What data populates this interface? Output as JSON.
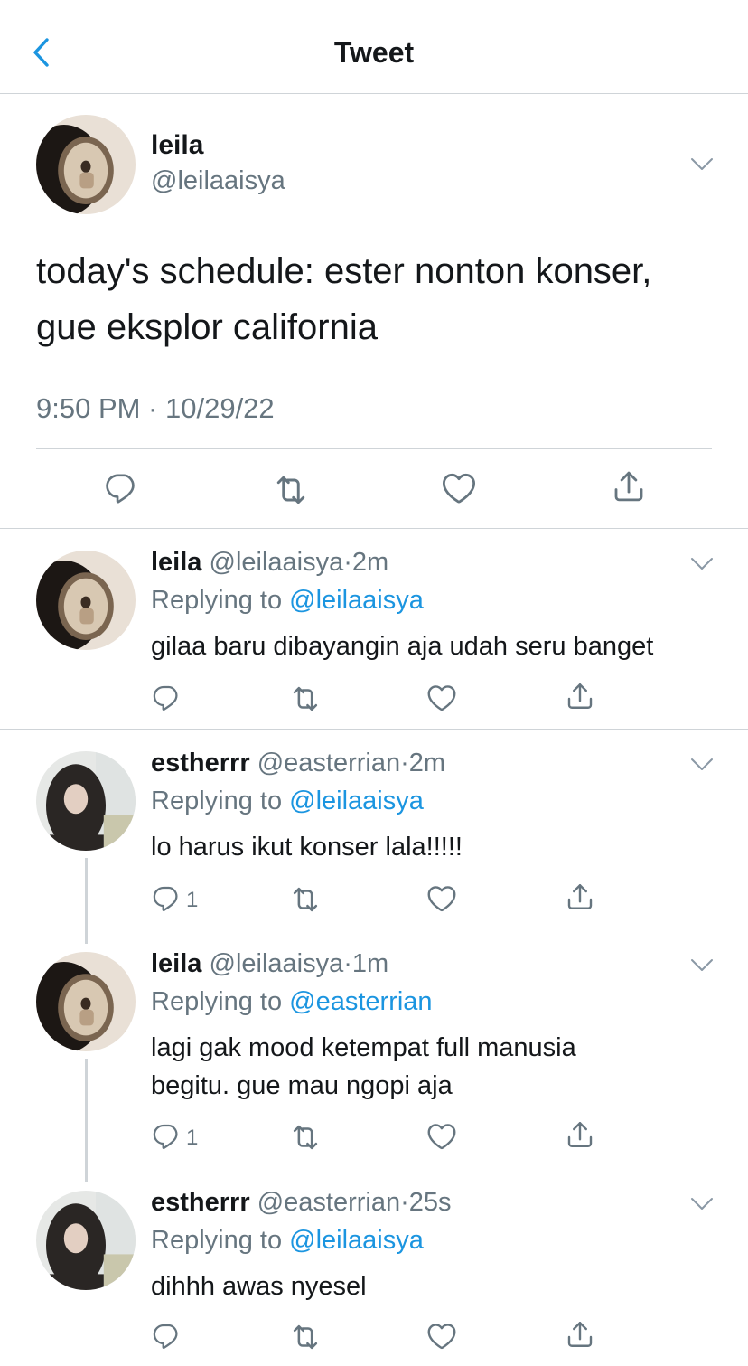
{
  "header": {
    "title": "Tweet"
  },
  "main_tweet": {
    "name": "leila",
    "handle": "@leilaaisya",
    "text_line1": "today's schedule: ester nonton konser,",
    "text_line2": "gue eksplor california",
    "timestamp": "9:50 PM · 10/29/22"
  },
  "replies": [
    {
      "name": "leila",
      "handle": "@leilaaisya",
      "time": "2m",
      "replying_label": "Replying to",
      "replying_to": "@leilaaisya",
      "text_line1": "gilaa baru dibayangin aja udah seru banget",
      "text_line2": "",
      "reply_count": ""
    },
    {
      "name": "estherrr",
      "handle": "@easterrian",
      "time": "2m",
      "replying_label": "Replying to",
      "replying_to": "@leilaaisya",
      "text_line1": "lo harus ikut konser lala!!!!!",
      "text_line2": "",
      "reply_count": "1"
    },
    {
      "name": "leila",
      "handle": "@leilaaisya",
      "time": "1m",
      "replying_label": "Replying to",
      "replying_to": "@easterrian",
      "text_line1": "lagi gak mood ketempat full manusia",
      "text_line2": "begitu. gue mau ngopi aja",
      "reply_count": "1"
    },
    {
      "name": "estherrr",
      "handle": "@easterrian",
      "time": "25s",
      "replying_label": "Replying to",
      "replying_to": "@leilaaisya",
      "text_line1": "dihhh awas nyesel",
      "text_line2": "",
      "reply_count": ""
    }
  ],
  "icons": {
    "back": "chevron-left-icon",
    "caret": "chevron-down-icon",
    "reply": "comment-icon",
    "retweet": "retweet-icon",
    "like": "heart-icon",
    "share": "share-icon"
  },
  "colors": {
    "accent": "#1b95e0",
    "text": "#14171a",
    "muted": "#66757f",
    "divider": "#cfd4d8"
  }
}
